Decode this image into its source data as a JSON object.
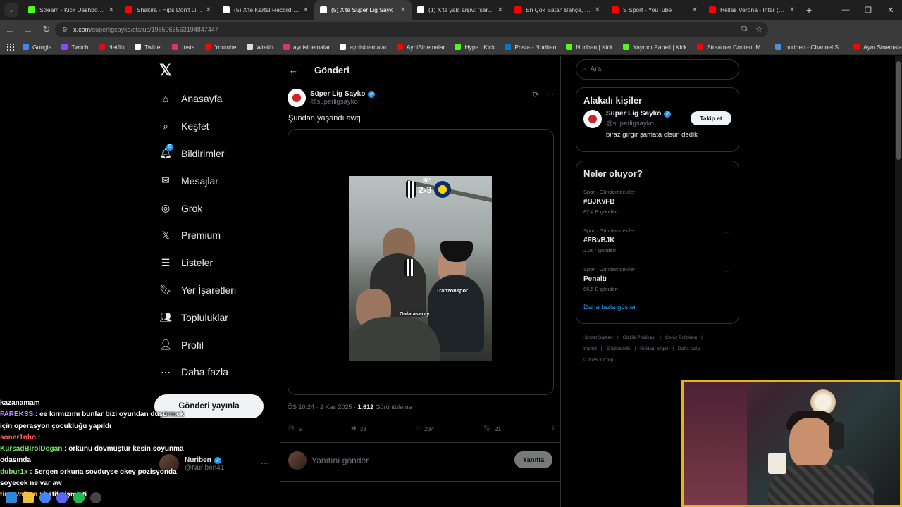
{
  "browser": {
    "tabs": [
      {
        "title": "Stream - Kick Dashboard",
        "color": "#53fc18",
        "active": false
      },
      {
        "title": "Shakira - Hips Don't Lie w",
        "color": "#ff0000",
        "active": false
      },
      {
        "title": "(5) X'te Kartal Record: \"M",
        "color": "#ffffff",
        "active": false
      },
      {
        "title": "(5) X'te Süper Lig Sayk",
        "color": "#ffffff",
        "active": true
      },
      {
        "title": "(1) X'te yalc arşiv: \"sergen",
        "color": "#ffffff",
        "active": false
      },
      {
        "title": "En Çok Satan Bahçe, Balk",
        "color": "#ff0000",
        "active": false
      },
      {
        "title": "S Sport - YouTube",
        "color": "#ff0000",
        "active": false
      },
      {
        "title": "Hellas Verona - Inter (1-2",
        "color": "#ff0000",
        "active": false
      }
    ],
    "url_host": "x.com",
    "url_path": "/superligsayko/status/1985065563194847447",
    "bookmarks": [
      {
        "label": "Google",
        "color": "#4285f4"
      },
      {
        "label": "Twitch",
        "color": "#9146ff"
      },
      {
        "label": "Netflix",
        "color": "#e50914"
      },
      {
        "label": "Twitter",
        "color": "#ffffff"
      },
      {
        "label": "Insta",
        "color": "#e1306c"
      },
      {
        "label": "Youtube",
        "color": "#ff0000"
      },
      {
        "label": "Wraith",
        "color": "#dddddd"
      },
      {
        "label": "aynisinemalar",
        "color": "#e1306c"
      },
      {
        "label": "aynisinemalar",
        "color": "#ffffff"
      },
      {
        "label": "AyniSinemalar",
        "color": "#ff0000"
      },
      {
        "label": "Hype | Kick",
        "color": "#53fc18"
      },
      {
        "label": "Posta - Nuriben",
        "color": "#0078d4"
      },
      {
        "label": "Nuriben | Kick",
        "color": "#53fc18"
      },
      {
        "label": "Yayıncı Paneli | Kick",
        "color": "#53fc18"
      },
      {
        "label": "Streamer Content M...",
        "color": "#ff0000"
      },
      {
        "label": "nuriben - Channel S...",
        "color": "#4a90e2"
      },
      {
        "label": "Aynı Sinemalar - Ça...",
        "color": "#ff0000"
      }
    ]
  },
  "nav": {
    "items": [
      {
        "label": "Anasayfa",
        "icon": "home-icon"
      },
      {
        "label": "Keşfet",
        "icon": "search-icon"
      },
      {
        "label": "Bildirimler",
        "icon": "bell-icon",
        "badge": "5"
      },
      {
        "label": "Mesajlar",
        "icon": "mail-icon"
      },
      {
        "label": "Grok",
        "icon": "grok-icon"
      },
      {
        "label": "Premium",
        "icon": "x-icon"
      },
      {
        "label": "Listeler",
        "icon": "list-icon"
      },
      {
        "label": "Yer İşaretleri",
        "icon": "bookmark-icon"
      },
      {
        "label": "Topluluklar",
        "icon": "community-icon"
      },
      {
        "label": "Profil",
        "icon": "profile-icon"
      },
      {
        "label": "Daha fazla",
        "icon": "more-icon"
      }
    ],
    "post_button": "Gönderi yayınla",
    "account_name": "Nuriben",
    "account_handle": "@Nuriben41"
  },
  "post": {
    "header_title": "Gönderi",
    "author_name": "Süper Lig Sayko",
    "author_handle": "@superligsayko",
    "text": "Şundan yaşandı awq",
    "media": {
      "score": "2-3",
      "minute": "90'",
      "label_trabzonspor": "Trabzonspor",
      "label_galatasaray": "Galatasaray"
    },
    "time": "ÖS 10:24 · 2 Kas 2025 · ",
    "views": "1.612",
    "views_label": " Görüntüleme",
    "replies": "5",
    "reposts": "33",
    "likes": "234",
    "bookmarks": "21",
    "reply_placeholder": "Yanıtını gönder",
    "reply_button": "Yanıtla"
  },
  "sidebar": {
    "search_placeholder": "Ara",
    "related_title": "Alakalı kişiler",
    "related": {
      "name": "Süper Lig Sayko",
      "handle": "@superligsayko",
      "bio": "biraz gırgır şamata olsun dedik",
      "follow": "Takip et"
    },
    "trends_title": "Neler oluyor?",
    "trends": [
      {
        "category": "Spor · Gündemdekiler",
        "name": "#BJKvFB",
        "count": "82,4 B gönderi"
      },
      {
        "category": "Spor · Gündemdekiler",
        "name": "#FBvBJK",
        "count": "2.067 gönderi"
      },
      {
        "category": "Spor · Gündemdekiler",
        "name": "Penaltı",
        "count": "66,5 B gönderi"
      }
    ],
    "show_more": "Daha fazla göster",
    "footer_line1": [
      "Hizmet Şartları",
      "|",
      "Gizlilik Politikası",
      "|",
      "Çerez Politikası",
      "|"
    ],
    "footer_line2": [
      "Imprint",
      "|",
      "Erişilebilirlik",
      "|",
      "Reklam bilgisi",
      "|",
      "Daha fazla ···"
    ],
    "footer_copy": "© 2025 X Corp."
  },
  "chat": [
    {
      "user": "",
      "msg": "kazanamam",
      "color": "#ffffff"
    },
    {
      "user": "FAREKSS",
      "msg": " : ee kırmızımı bunlar bizi oyundan düşürmek için operasyon çocukluğu yapıldı",
      "color": "#b58cff"
    },
    {
      "user": "soner1nho",
      "msg": " : ",
      "color": "#ff5a5a"
    },
    {
      "user": "KursadBirolDogan",
      "msg": " : orkunu dövmüştür kesin soyunma odasında",
      "color": "#7ee36a"
    },
    {
      "user": "dubur1x",
      "msg": " : Sergen orkuna sovduyse okey pozisyonda soyecek ne var aw",
      "color": "#7ee36a"
    },
    {
      "user": "tintaVolkan",
      "msg": " : hafif şişmişti",
      "color": "#ffb347"
    }
  ]
}
